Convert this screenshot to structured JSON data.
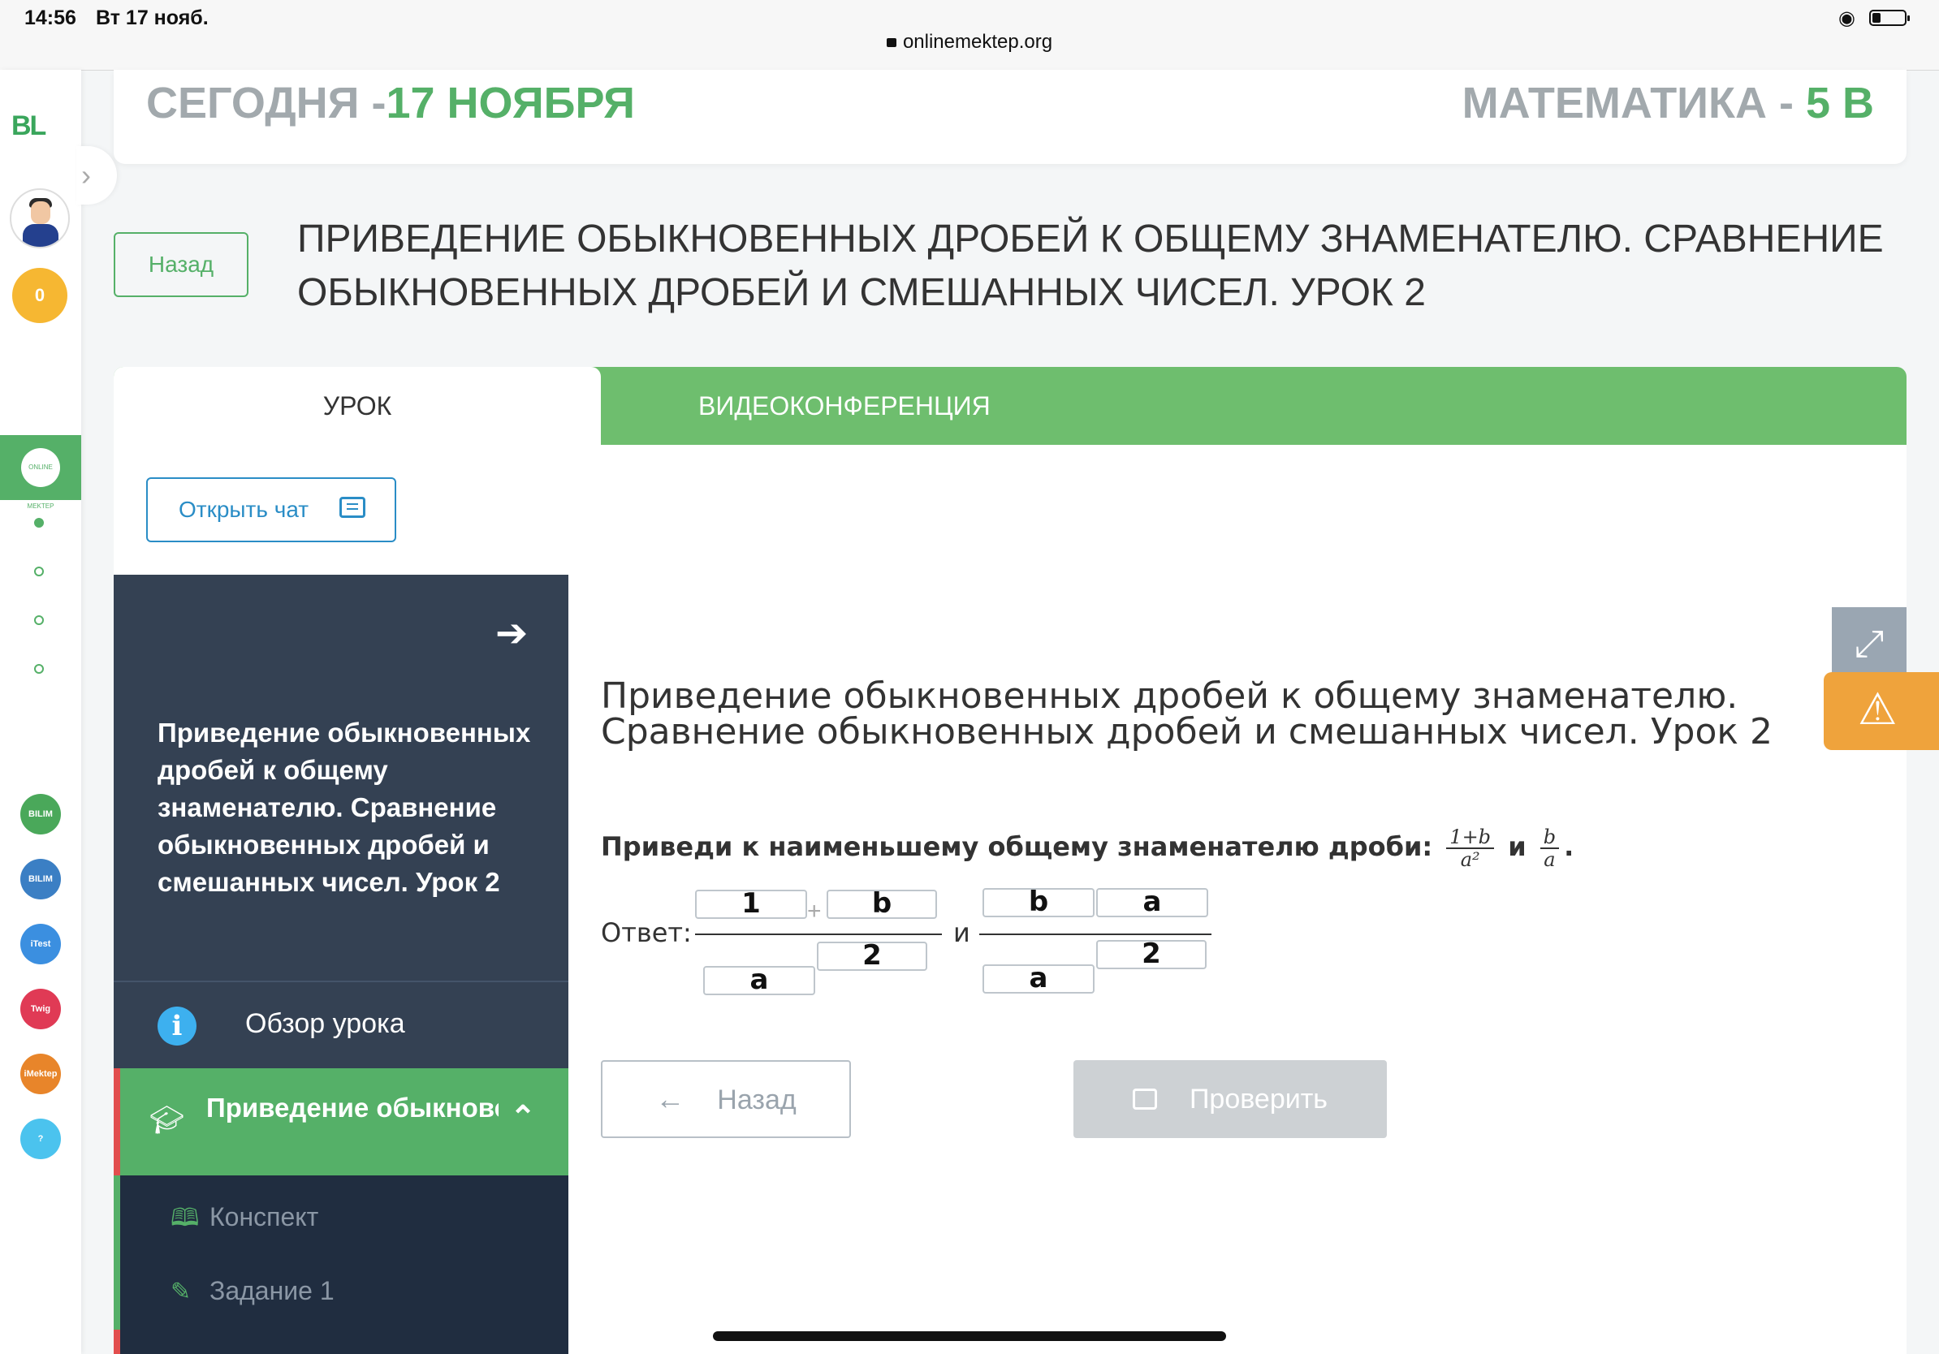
{
  "status_bar": {
    "time": "14:56",
    "date": "Вт 17 нояб.",
    "url": "onlinemektep.org"
  },
  "rail": {
    "logo": "BL",
    "coins": "0",
    "active_app": "ONLINE MEKTEP",
    "apps": [
      {
        "label": "BILIM Land",
        "color": "#4aa85a"
      },
      {
        "label": "BILIM Book",
        "color": "#3b7fc4"
      },
      {
        "label": "iTest",
        "color": "#3b8fe0"
      },
      {
        "label": "Twig",
        "color": "#e03a55"
      },
      {
        "label": "iMektep",
        "color": "#e8852a"
      },
      {
        "label": "?",
        "color": "#4bc3ee"
      }
    ]
  },
  "header": {
    "today_label": "СЕГОДНЯ -",
    "today_date": "17 НОЯБРЯ",
    "subject_label": "МАТЕМАТИКА -",
    "class_name": "5 В"
  },
  "back_button": "Назад",
  "lesson_title": "ПРИВЕДЕНИЕ ОБЫКНОВЕННЫХ ДРОБЕЙ К ОБЩЕМУ ЗНАМЕНАТЕЛЮ. СРАВНЕНИЕ ОБЫКНОВЕННЫХ ДРОБЕЙ И СМЕШАННЫХ ЧИСЕЛ. УРОК 2",
  "tabs": [
    {
      "label": "УРОК",
      "active": true
    },
    {
      "label": "ВИДЕОКОНФЕРЕНЦИЯ",
      "active": false
    }
  ],
  "open_chat": "Открыть чат",
  "lesson_sidebar": {
    "title": "Приведение обыкновенных дробей к общему знаменателю. Сравнение обыкновенных дробей и смешанных чисел. Урок 2",
    "overview": "Обзор урока",
    "section": "Приведение обыкновенных др...",
    "items": [
      {
        "label": "Конспект",
        "icon": "book-icon"
      },
      {
        "label": "Задание 1",
        "icon": "edit-icon"
      }
    ]
  },
  "task": {
    "title": "Приведение обыкновенных дробей к общему знаменателю. Сравнение обыкновенных дробей и смешанных чисел. Урок 2",
    "question": "Приведи к наименьшему общему знаменателю дроби:",
    "frac1_num": "1+b",
    "frac1_den": "a²",
    "conj": "и",
    "frac2_num": "b",
    "frac2_den": "a",
    "period": ".",
    "answer_label": "Ответ:",
    "answer": {
      "f1_num_a": "1",
      "plus": "+",
      "f1_num_b": "b",
      "f1_den_mult": "2",
      "f1_den": "a",
      "and": "и",
      "f2_num_a": "b",
      "f2_num_b": "a",
      "f2_den_mult": "2",
      "f2_den": "a"
    },
    "back_button": "Назад",
    "check_button": "Проверить"
  },
  "colors": {
    "accent": "#55b068",
    "sidebar": "#344153",
    "warning": "#efa33c",
    "link": "#2a8dc6"
  }
}
